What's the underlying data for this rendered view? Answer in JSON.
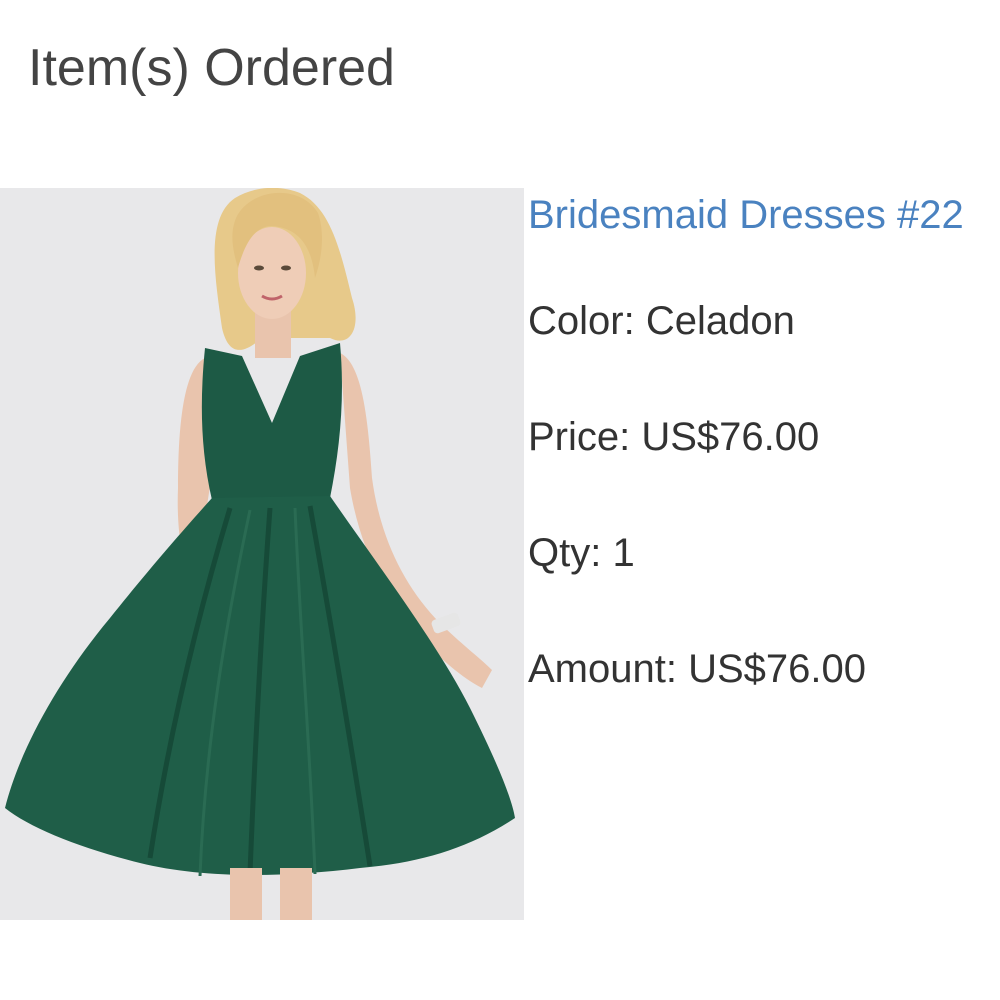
{
  "section": {
    "title": "Item(s) Ordered"
  },
  "item": {
    "image_icon": "dress-photo",
    "name": "Bridesmaid Dresses #22",
    "color_line": "Color: Celadon",
    "price_line": "Price: US$76.00",
    "qty_line": "Qty: 1",
    "amount_line": "Amount: US$76.00"
  },
  "colors": {
    "link": "#4a82c0",
    "dress": "#1d5a45",
    "background": "#e8e8ea"
  }
}
